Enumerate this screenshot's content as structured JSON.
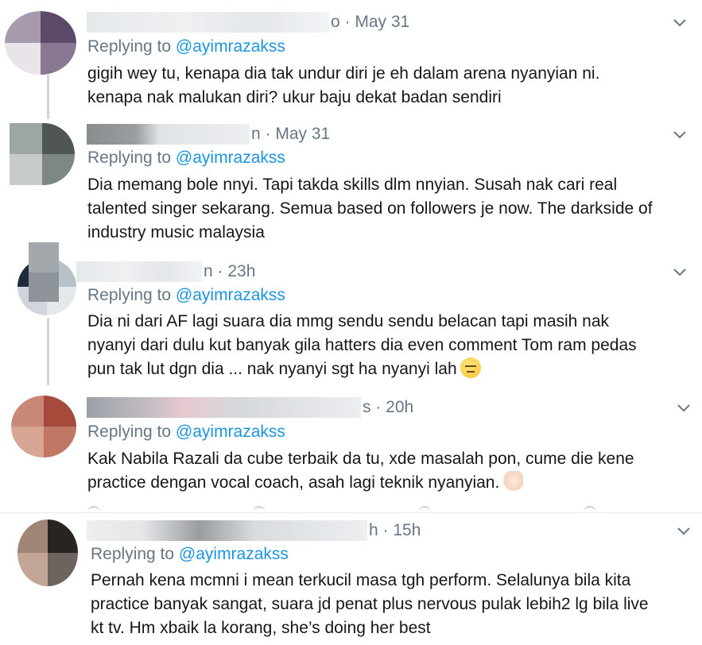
{
  "colors": {
    "link": "#1b95e0",
    "secondary_text": "#657786",
    "primary_text": "#14171a",
    "thread_line": "#ccd6dd"
  },
  "tweets": [
    {
      "name_fragment": "",
      "tail_fragment": "o",
      "time": "May 31",
      "replying_prefix": "Replying to ",
      "mention": "@ayimrazakss",
      "text": "gigih wey tu, kenapa dia tak undur diri je eh dalam arena nyanyian ni.\nkenapa nak malukan diri? ukur baju dekat badan sendiri"
    },
    {
      "name_fragment": "",
      "tail_fragment": "n",
      "time": "May 31",
      "replying_prefix": "Replying to ",
      "mention": "@ayimrazakss",
      "text": "Dia memang bole nnyi. Tapi takda skills dlm nnyian. Susah nak cari real\ntalented singer sekarang. Semua based on followers je now. The darkside of\nindustry music malaysia"
    },
    {
      "name_fragment": "",
      "tail_fragment": "n",
      "time": "23h",
      "replying_prefix": "Replying to ",
      "mention": "@ayimrazakss",
      "text": "Dia ni dari AF lagi suara dia mmg sendu sendu belacan tapi masih nak\nnyanyi dari dulu kut banyak gila hatters dia even comment Tom ram pedas\npun tak lut dgn dia ... nak nyanyi sgt ha nyanyi lah",
      "emoji": "expressionless-face-icon"
    },
    {
      "name_fragment": "",
      "tail_fragment": "s",
      "time": "20h",
      "replying_prefix": "Replying to ",
      "mention": "@ayimrazakss",
      "text": "Kak Nabila Razali da cube terbaik da tu, xde masalah pon, cume die kene\npractice dengan vocal coach, asah lagi teknik nyanyian.",
      "emoji": "flexed-biceps-icon"
    },
    {
      "name_fragment": "",
      "tail_fragment": "h",
      "time": "15h",
      "replying_prefix": "Replying to ",
      "mention": "@ayimrazakss",
      "text": "Pernah kena mcmni i mean terkucil masa tgh perform. Selalunya bila kita\npractice banyak sangat, suara jd penat plus nervous pulak lebih2 lg bila live\nkt tv. Hm xbaik la korang, she’s doing her best"
    }
  ]
}
